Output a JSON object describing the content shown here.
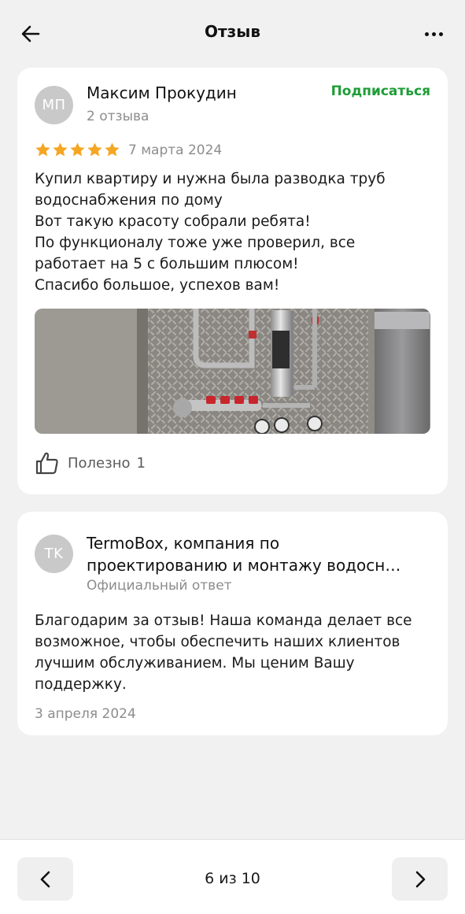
{
  "header": {
    "title": "Отзыв",
    "back_icon": "arrow-left-icon",
    "more_icon": "more-horizontal-icon"
  },
  "review": {
    "avatar_initials": "МП",
    "author": "Максим Прокудин",
    "author_reviews": "2 отзыва",
    "subscribe_label": "Подписаться",
    "rating": 5,
    "date": "7 марта 2024",
    "text_lines": [
      "Купил квартиру и нужна была разводка труб",
      "водоснабжения по дому",
      "Вот такую красоту собрали ребята!",
      "По функционалу тоже уже проверил, все",
      "работает на 5 с большим плюсом!",
      "Спасибо большое, успехов вам!"
    ],
    "helpful_label": "Полезно",
    "helpful_count": "1"
  },
  "reply": {
    "avatar_initials": "TK",
    "author_line1": "TermoBox, компания по",
    "author_line2": "проектированию и монтажу водосн…",
    "label": "Официальный ответ",
    "text_lines": [
      "Благодарим за отзыв! Наша команда делает все",
      "возможное, чтобы обеспечить наших клиентов",
      "лучшим обслуживанием. Мы ценим Вашу",
      "поддержку."
    ],
    "date": "3 апреля 2024"
  },
  "footer": {
    "pager": "6 из 10",
    "prev_icon": "chevron-left-icon",
    "next_icon": "chevron-right-icon"
  },
  "colors": {
    "accent_green": "#1f9d37",
    "star_gold": "#f5a623",
    "background": "#f1f1f1"
  }
}
